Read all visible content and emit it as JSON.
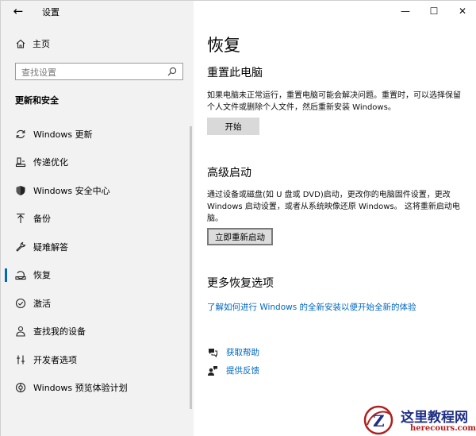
{
  "window": {
    "title": "设置",
    "controls": {
      "minimize": "—",
      "maximize": "☐",
      "close": "✕"
    }
  },
  "sidebar": {
    "home_label": "主页",
    "search_placeholder": "查找设置",
    "section_title": "更新和安全",
    "items": [
      {
        "label": "Windows 更新",
        "icon": "sync-icon"
      },
      {
        "label": "传递优化",
        "icon": "delivery-optimization-icon"
      },
      {
        "label": "Windows 安全中心",
        "icon": "shield-icon"
      },
      {
        "label": "备份",
        "icon": "backup-arrow-icon"
      },
      {
        "label": "疑难解答",
        "icon": "wrench-icon"
      },
      {
        "label": "恢复",
        "icon": "recovery-icon",
        "active": true
      },
      {
        "label": "激活",
        "icon": "check-circle-icon"
      },
      {
        "label": "查找我的设备",
        "icon": "find-device-icon"
      },
      {
        "label": "开发者选项",
        "icon": "developer-icon"
      },
      {
        "label": "Windows 预览体验计划",
        "icon": "insider-icon"
      }
    ]
  },
  "main": {
    "title": "恢复",
    "reset": {
      "heading": "重置此电脑",
      "description": "如果电脑未正常运行，重置电脑可能会解决问题。重置时，可以选择保留个人文件或删除个人文件，然后重新安装 Windows。",
      "button": "开始"
    },
    "advanced": {
      "heading": "高级启动",
      "description": "通过设备或磁盘(如 U 盘或 DVD)启动，更改你的电脑固件设置，更改 Windows 启动设置，或者从系统映像还原 Windows。 这将重新启动电脑。",
      "button": "立即重新启动"
    },
    "more": {
      "heading": "更多恢复选项",
      "link": "了解如何进行 Windows 的全新安装以便开始全新的体验"
    },
    "help": {
      "get_help": "获取帮助",
      "feedback": "提供反馈"
    }
  },
  "watermark": {
    "text": "这里教程网",
    "url": "herecours.com"
  },
  "colors": {
    "accent": "#0067c0",
    "sidebar_bg": "#f2f2f2",
    "button_bg": "#d9d9d9"
  }
}
